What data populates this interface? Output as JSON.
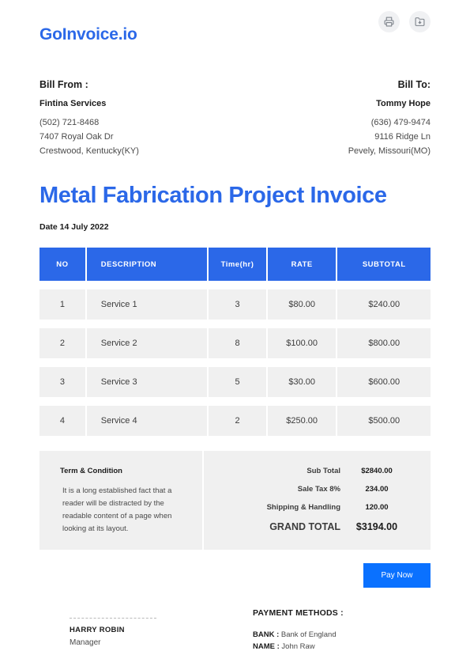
{
  "header": {
    "brand": "GoInvoice.io",
    "actions": [
      {
        "name": "print-button",
        "icon": "printer-icon"
      },
      {
        "name": "download-button",
        "icon": "folder-download-icon"
      }
    ]
  },
  "bill_from": {
    "title": "Bill From :",
    "name": "Fintina Services",
    "phone": "(502) 721-8468",
    "street": "7407 Royal Oak Dr",
    "city": "Crestwood, Kentucky(KY)"
  },
  "bill_to": {
    "title": "Bill To:",
    "name": "Tommy Hope",
    "phone": "(636) 479-9474",
    "street": "9116 Ridge Ln",
    "city": "Pevely, Missouri(MO)"
  },
  "invoice": {
    "title": "Metal Fabrication Project Invoice",
    "date": "Date 14 July 2022"
  },
  "table": {
    "columns": [
      "NO",
      "DESCRIPTION",
      "Time(hr)",
      "RATE",
      "SUBTOTAL"
    ],
    "rows": [
      {
        "no": "1",
        "description": "Service 1",
        "time": "3",
        "rate": "$80.00",
        "subtotal": "$240.00"
      },
      {
        "no": "2",
        "description": "Service 2",
        "time": "8",
        "rate": "$100.00",
        "subtotal": "$800.00"
      },
      {
        "no": "3",
        "description": "Service 3",
        "time": "5",
        "rate": "$30.00",
        "subtotal": "$600.00"
      },
      {
        "no": "4",
        "description": "Service 4",
        "time": "2",
        "rate": "$250.00",
        "subtotal": "$500.00"
      }
    ]
  },
  "terms": {
    "title": "Term & Condition",
    "body": "It is a long established fact that a reader will be distracted by the readable content of a page when looking at its layout."
  },
  "totals": {
    "sub_total_label": "Sub Total",
    "sub_total_value": "$2840.00",
    "tax_label": "Sale Tax 8%",
    "tax_value": "234.00",
    "shipping_label": "Shipping & Handling",
    "shipping_value": "120.00",
    "grand_label": "GRAND TOTAL",
    "grand_value": "$3194.00"
  },
  "pay_button": {
    "label": "Pay Now"
  },
  "signature": {
    "name": "HARRY ROBIN",
    "role": "Manager"
  },
  "payment_methods": {
    "title": "PAYMENT METHODS :",
    "bank_label": "BANK :",
    "bank_value": "Bank of England",
    "name_label": "NAME :",
    "name_value": "John Raw"
  },
  "colors": {
    "accent": "#2b68e8",
    "button": "#0a71ff",
    "row_bg": "#f0f0f0"
  }
}
